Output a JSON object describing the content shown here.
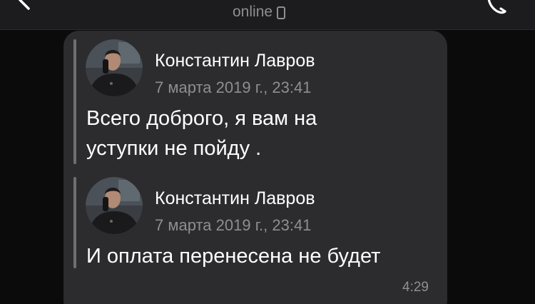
{
  "header": {
    "status": "online"
  },
  "message": {
    "forwards": [
      {
        "sender": "Константин Лавров",
        "date": "7 марта 2019 г., 23:41",
        "text": "Всего доброго, я вам на\nуступки не пойду ."
      },
      {
        "sender": "Константин Лавров",
        "date": "7 марта 2019 г., 23:41",
        "text": "И оплата перенесена не будет"
      }
    ],
    "time": "4:29"
  },
  "colors": {
    "background": "#0b0b0c",
    "bubble": "#2c2c2e",
    "secondary_text": "#8e8e93",
    "primary_text": "#ffffff"
  }
}
